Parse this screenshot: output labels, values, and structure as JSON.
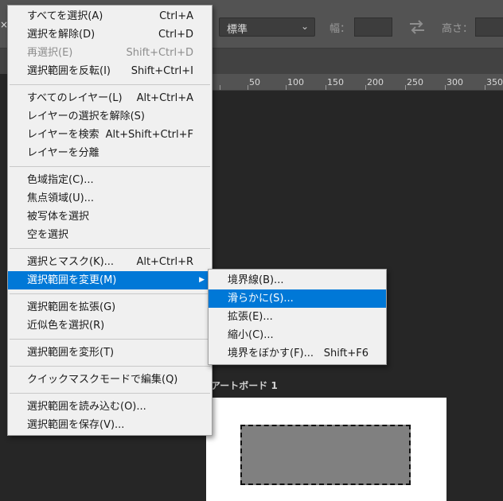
{
  "options_bar": {
    "left_glyph": "×",
    "style_value": "標準",
    "width_label": "幅：",
    "height_label": "高さ："
  },
  "ruler": {
    "ticks": [
      "50",
      "100",
      "150",
      "200",
      "250",
      "300",
      "350"
    ]
  },
  "canvas": {
    "artboard_label": "アートボード 1"
  },
  "menu": {
    "items": [
      {
        "label": "すべてを選択(A)",
        "shortcut": "Ctrl+A"
      },
      {
        "label": "選択を解除(D)",
        "shortcut": "Ctrl+D"
      },
      {
        "label": "再選択(E)",
        "shortcut": "Shift+Ctrl+D",
        "disabled": true
      },
      {
        "label": "選択範囲を反転(I)",
        "shortcut": "Shift+Ctrl+I"
      },
      {
        "label": "すべてのレイヤー(L)",
        "shortcut": "Alt+Ctrl+A"
      },
      {
        "label": "レイヤーの選択を解除(S)",
        "shortcut": ""
      },
      {
        "label": "レイヤーを検索",
        "shortcut": "Alt+Shift+Ctrl+F"
      },
      {
        "label": "レイヤーを分離",
        "shortcut": ""
      },
      {
        "label": "色域指定(C)...",
        "shortcut": ""
      },
      {
        "label": "焦点領域(U)...",
        "shortcut": ""
      },
      {
        "label": "被写体を選択",
        "shortcut": ""
      },
      {
        "label": "空を選択",
        "shortcut": ""
      },
      {
        "label": "選択とマスク(K)...",
        "shortcut": "Alt+Ctrl+R"
      },
      {
        "label": "選択範囲を変更(M)",
        "shortcut": "",
        "highlighted": true,
        "submenu": true
      },
      {
        "label": "選択範囲を拡張(G)",
        "shortcut": ""
      },
      {
        "label": "近似色を選択(R)",
        "shortcut": ""
      },
      {
        "label": "選択範囲を変形(T)",
        "shortcut": ""
      },
      {
        "label": "クイックマスクモードで編集(Q)",
        "shortcut": ""
      },
      {
        "label": "選択範囲を読み込む(O)...",
        "shortcut": ""
      },
      {
        "label": "選択範囲を保存(V)...",
        "shortcut": ""
      }
    ]
  },
  "submenu": {
    "items": [
      {
        "label": "境界線(B)...",
        "shortcut": ""
      },
      {
        "label": "滑らかに(S)...",
        "shortcut": "",
        "highlighted": true
      },
      {
        "label": "拡張(E)...",
        "shortcut": ""
      },
      {
        "label": "縮小(C)...",
        "shortcut": ""
      },
      {
        "label": "境界をぼかす(F)...",
        "shortcut": "Shift+F6"
      }
    ]
  }
}
